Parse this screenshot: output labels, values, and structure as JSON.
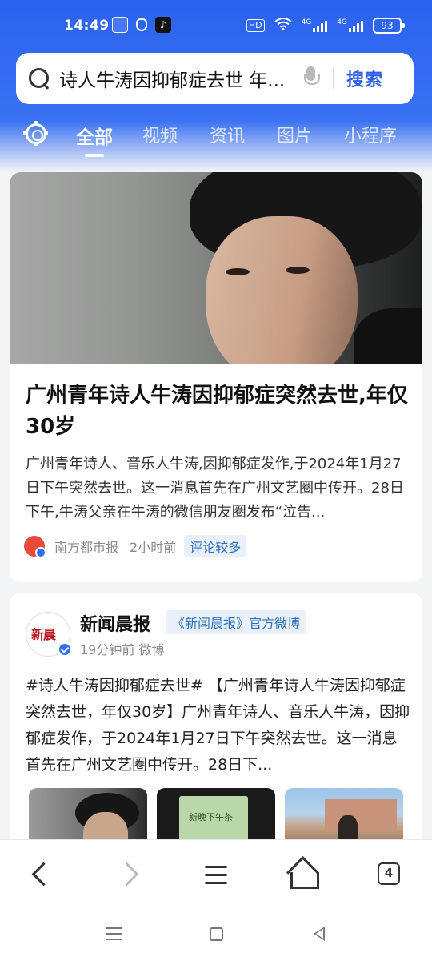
{
  "status_bar": {
    "time": "14:49",
    "network_badge": "HD",
    "signal_1_label": "4G",
    "signal_2_label": "4G",
    "battery": "93"
  },
  "search": {
    "query": "诗人牛涛因抑郁症去世 年...",
    "button_label": "搜索"
  },
  "tabs": [
    {
      "label": "全部",
      "active": true
    },
    {
      "label": "视频",
      "active": false
    },
    {
      "label": "资讯",
      "active": false
    },
    {
      "label": "图片",
      "active": false
    },
    {
      "label": "小程序",
      "active": false
    }
  ],
  "news_card": {
    "title": "广州青年诗人牛涛因抑郁症突然去世,年仅30岁",
    "summary": "广州青年诗人、音乐人牛涛,因抑郁症发作,于2024年1月27日下午突然去世。这一消息首先在广州文艺圈中传开。28日下午,牛涛父亲在牛涛的微信朋友圈发布“泣告...",
    "source": "南方都市报",
    "time": "2小时前",
    "badge": "评论较多"
  },
  "weibo_card": {
    "account": "新闻晨报",
    "avatar_text": "新晨",
    "tag": "《新闻晨报》官方微博",
    "meta": "19分钟前 微博",
    "text": "#诗人牛涛因抑郁症去世# 【广州青年诗人牛涛因抑郁症突然去世，年仅30岁】广州青年诗人、音乐人牛涛，因抑郁症发作，于2024年1月27日下午突然去世。这一消息首先在广州文艺圈中传开。28日下...",
    "thumb2_text": "新晚下午茶"
  },
  "bottom_nav": {
    "tab_count": "4"
  },
  "colors": {
    "brand_blue": "#2b62ee",
    "link_blue": "#2f5fe8",
    "badge_bg": "#e8f1fb"
  }
}
